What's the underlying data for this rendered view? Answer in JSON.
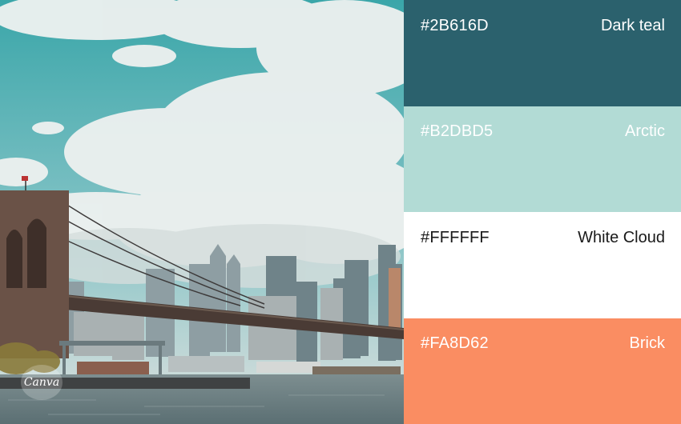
{
  "palette": [
    {
      "hex": "#2B616D",
      "name": "Dark teal",
      "bg": "#2B616D",
      "text": "#FFFFFF"
    },
    {
      "hex": "#B2DBD5",
      "name": "Arctic",
      "bg": "#B2DBD5",
      "text": "#FFFFFF"
    },
    {
      "hex": "#FFFFFF",
      "name": "White Cloud",
      "bg": "#FFFFFF",
      "text": "#1A1A1A"
    },
    {
      "hex": "#FA8D62",
      "name": "Brick",
      "bg": "#FA8D62",
      "text": "#FFFFFF"
    }
  ],
  "watermark": {
    "text": "Canva"
  },
  "photo": {
    "subject": "bridge-skyline-photo"
  }
}
